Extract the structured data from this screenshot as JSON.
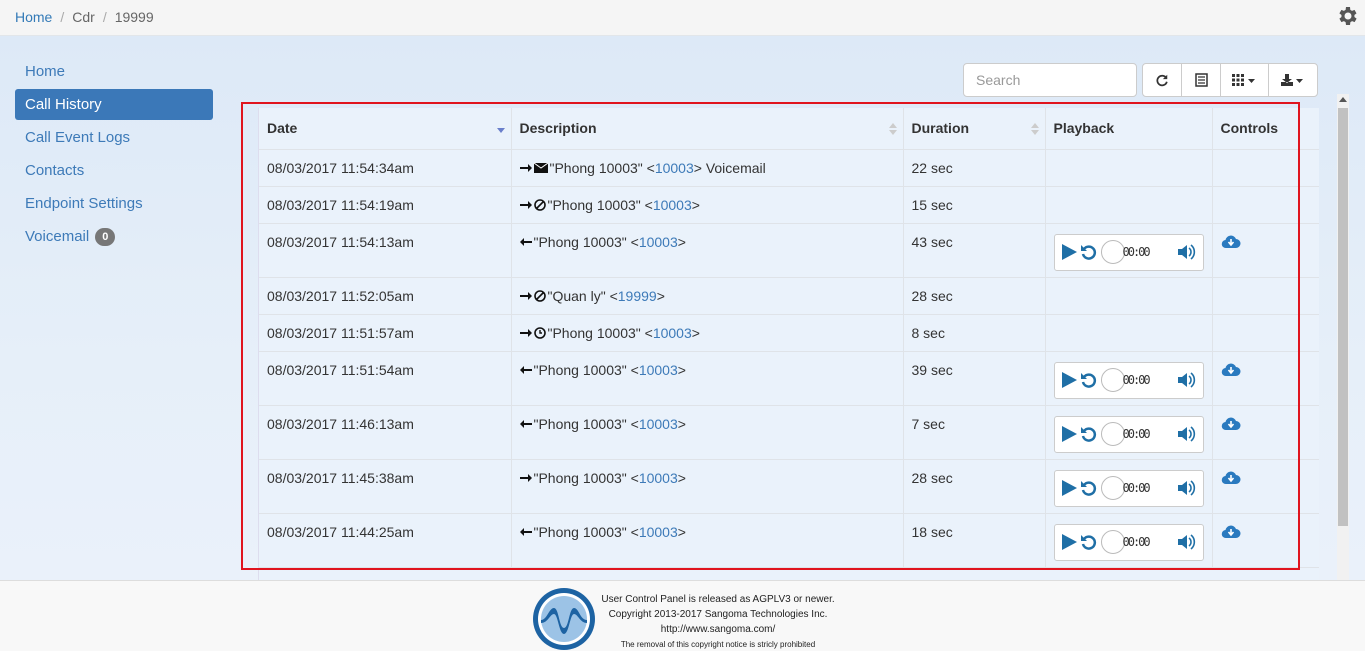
{
  "breadcrumb": {
    "home": "Home",
    "cdr": "Cdr",
    "current": "19999"
  },
  "sidebar": {
    "items": [
      {
        "label": "Home"
      },
      {
        "label": "Call History"
      },
      {
        "label": "Call Event Logs"
      },
      {
        "label": "Contacts"
      },
      {
        "label": "Endpoint Settings"
      },
      {
        "label": "Voicemail",
        "badge": "0"
      }
    ]
  },
  "toolbar": {
    "search_placeholder": "Search"
  },
  "table": {
    "headers": {
      "date": "Date",
      "description": "Description",
      "duration": "Duration",
      "playback": "Playback",
      "controls": "Controls"
    },
    "rows": [
      {
        "date": "08/03/2017 11:54:34am",
        "direction": "out",
        "status": "voicemail",
        "name": "\"Phong 10003\" <",
        "ext": "10003",
        "suffix": "> Voicemail",
        "duration": "22 sec",
        "has_recording": false
      },
      {
        "date": "08/03/2017 11:54:19am",
        "direction": "out",
        "status": "no-answer",
        "name": "\"Phong 10003\" <",
        "ext": "10003",
        "suffix": ">",
        "duration": "15 sec",
        "has_recording": false
      },
      {
        "date": "08/03/2017 11:54:13am",
        "direction": "in",
        "status": "",
        "name": "\"Phong 10003\" <",
        "ext": "10003",
        "suffix": ">",
        "duration": "43 sec",
        "has_recording": true
      },
      {
        "date": "08/03/2017 11:52:05am",
        "direction": "out",
        "status": "no-answer",
        "name": "\"Quan ly\" <",
        "ext": "19999",
        "suffix": ">",
        "duration": "28 sec",
        "has_recording": false
      },
      {
        "date": "08/03/2017 11:51:57am",
        "direction": "out",
        "status": "clock",
        "name": "\"Phong 10003\" <",
        "ext": "10003",
        "suffix": ">",
        "duration": "8 sec",
        "has_recording": false
      },
      {
        "date": "08/03/2017 11:51:54am",
        "direction": "in",
        "status": "",
        "name": "\"Phong 10003\" <",
        "ext": "10003",
        "suffix": ">",
        "duration": "39 sec",
        "has_recording": true
      },
      {
        "date": "08/03/2017 11:46:13am",
        "direction": "in",
        "status": "",
        "name": "\"Phong 10003\" <",
        "ext": "10003",
        "suffix": ">",
        "duration": "7 sec",
        "has_recording": true
      },
      {
        "date": "08/03/2017 11:45:38am",
        "direction": "out",
        "status": "",
        "name": "\"Phong 10003\" <",
        "ext": "10003",
        "suffix": ">",
        "duration": "28 sec",
        "has_recording": true
      },
      {
        "date": "08/03/2017 11:44:25am",
        "direction": "in",
        "status": "",
        "name": "\"Phong 10003\" <",
        "ext": "10003",
        "suffix": ">",
        "duration": "18 sec",
        "has_recording": true
      }
    ]
  },
  "player": {
    "track_text": "00:00"
  },
  "colors": {
    "accent": "#3b78b8",
    "player_icon": "#1f6fa6",
    "highlight": "#e0141e"
  },
  "footer": {
    "line1": "User Control Panel is released as AGPLV3 or newer.",
    "line2": "Copyright 2013-2017 Sangoma Technologies Inc.",
    "line3": "http://www.sangoma.com/",
    "line4": "The removal of this copyright notice is stricly prohibited"
  }
}
